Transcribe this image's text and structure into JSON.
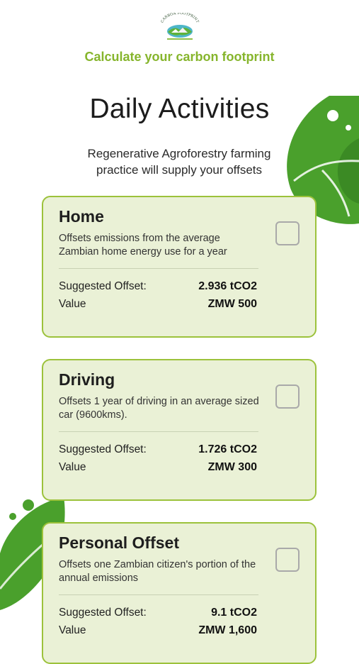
{
  "header": {
    "logo_text": "CARBON FOOTPRINT",
    "subtitle": "Calculate your carbon footprint"
  },
  "page": {
    "title": "Daily Activities",
    "intro": "Regenerative Agroforestry farming practice will supply your offsets"
  },
  "labels": {
    "suggested_offset": "Suggested Offset:",
    "value": "Value"
  },
  "cards": [
    {
      "title": "Home",
      "description": "Offsets emissions from the average Zambian home energy use for a year",
      "offset": "2.936 tCO2",
      "value": "ZMW 500",
      "checked": false
    },
    {
      "title": "Driving",
      "description": "Offsets 1 year of driving in an average sized car (9600kms).",
      "offset": "1.726 tCO2",
      "value": "ZMW 300",
      "checked": false
    },
    {
      "title": "Personal Offset",
      "description": "Offsets one Zambian citizen's portion of the annual emissions",
      "offset": "9.1 tCO2",
      "value": "ZMW 1,600",
      "checked": false
    }
  ],
  "colors": {
    "accent": "#86b52c",
    "card_bg": "#eaf1d6",
    "card_border": "#9cc23b",
    "leaf": "#4aa02c"
  }
}
